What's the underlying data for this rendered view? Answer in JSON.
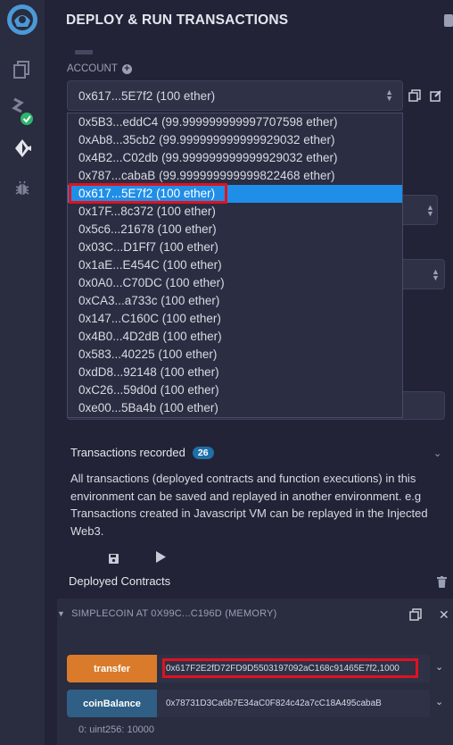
{
  "header": {
    "title": "DEPLOY & RUN TRANSACTIONS"
  },
  "account": {
    "label": "ACCOUNT",
    "selected": "0x617...5E7f2 (100 ether)",
    "options": [
      "0x5B3...eddC4 (99.999999999997707598 ether)",
      "0xAb8...35cb2 (99.999999999999929032 ether)",
      "0x4B2...C02db (99.999999999999929032 ether)",
      "0x787...cabaB (99.999999999999822468 ether)",
      "0x617...5E7f2 (100 ether)",
      "0x17F...8c372 (100 ether)",
      "0x5c6...21678 (100 ether)",
      "0x03C...D1Ff7 (100 ether)",
      "0x1aE...E454C (100 ether)",
      "0x0A0...C70DC (100 ether)",
      "0xCA3...a733c (100 ether)",
      "0x147...C160C (100 ether)",
      "0x4B0...4D2dB (100 ether)",
      "0x583...40225 (100 ether)",
      "0xdD8...92148 (100 ether)",
      "0xC26...59d0d (100 ether)",
      "0xe00...5Ba4b (100 ether)"
    ],
    "selected_index": 4
  },
  "transactions": {
    "label": "Transactions recorded",
    "count": "26",
    "description": "All transactions (deployed contracts and function executions) in this environment can be saved and replayed in another environment. e.g Transactions created in Javascript VM can be replayed in the Injected Web3."
  },
  "deployed": {
    "label": "Deployed Contracts",
    "instance_title": "SIMPLECOIN AT 0X99C...C196D (MEMORY)",
    "functions": [
      {
        "name": "transfer",
        "value": "0x617F2E2fD72FD9D5503197092aC168c91465E7f2,1000",
        "color": "#d97b2b"
      },
      {
        "name": "coinBalance",
        "value": "0x78731D3Ca6b7E34aC0F824c42a7cC18A495cabaB",
        "color": "#2f5f84"
      }
    ],
    "result_key": "0:",
    "result_value": "uint256: 10000"
  },
  "icons": [
    "remix-logo-icon",
    "file-explorer-icon",
    "compiler-icon",
    "deploy-run-icon",
    "debugger-icon",
    "copy-icon",
    "edit-icon",
    "save-icon",
    "play-icon",
    "trash-icon",
    "close-icon",
    "chevron-down-icon"
  ]
}
